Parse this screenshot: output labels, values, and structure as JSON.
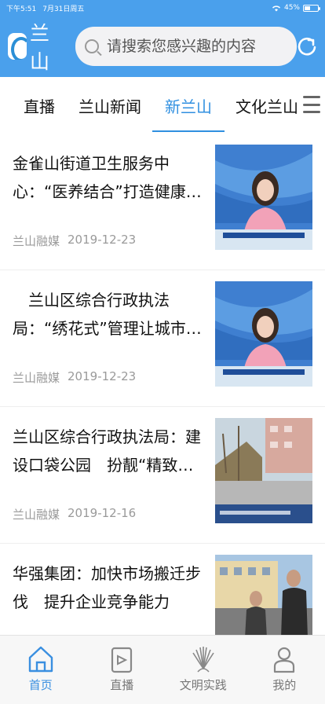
{
  "status": {
    "time": "下午5:51",
    "date": "7月31日周五",
    "battery": "45%",
    "battery_level": 0.45
  },
  "header": {
    "logo_text": "兰山",
    "search_placeholder": "请搜索您感兴趣的内容"
  },
  "tabs": [
    {
      "label": "直播"
    },
    {
      "label": "兰山新闻"
    },
    {
      "label": "新兰山",
      "active": true
    },
    {
      "label": "文化兰山"
    }
  ],
  "feed": [
    {
      "title": "金雀山街道卫生服务中心：“医养结合”打造健康养老...",
      "source": "兰山融媒",
      "date": "2019-12-23",
      "thumb": "news-anchor"
    },
    {
      "title": "　兰山区综合行政执法局：“绣花式”管理让城市管理...",
      "source": "兰山融媒",
      "date": "2019-12-23",
      "thumb": "news-anchor"
    },
    {
      "title": "兰山区综合行政执法局：建设口袋公园　扮靓“精致城...",
      "source": "兰山融媒",
      "date": "2019-12-16",
      "thumb": "park-scene"
    },
    {
      "title": "华强集团：加快市场搬迁步伐　提升企业竞争能力",
      "source": "",
      "date": "",
      "thumb": "people-scene"
    }
  ],
  "tabbar": [
    {
      "label": "首页",
      "icon": "home-icon",
      "active": true
    },
    {
      "label": "直播",
      "icon": "video-icon"
    },
    {
      "label": "文明实践",
      "icon": "sunburst-icon"
    },
    {
      "label": "我的",
      "icon": "user-icon"
    }
  ],
  "colors": {
    "brand": "#4aa0ec",
    "active": "#2f8fe0"
  }
}
